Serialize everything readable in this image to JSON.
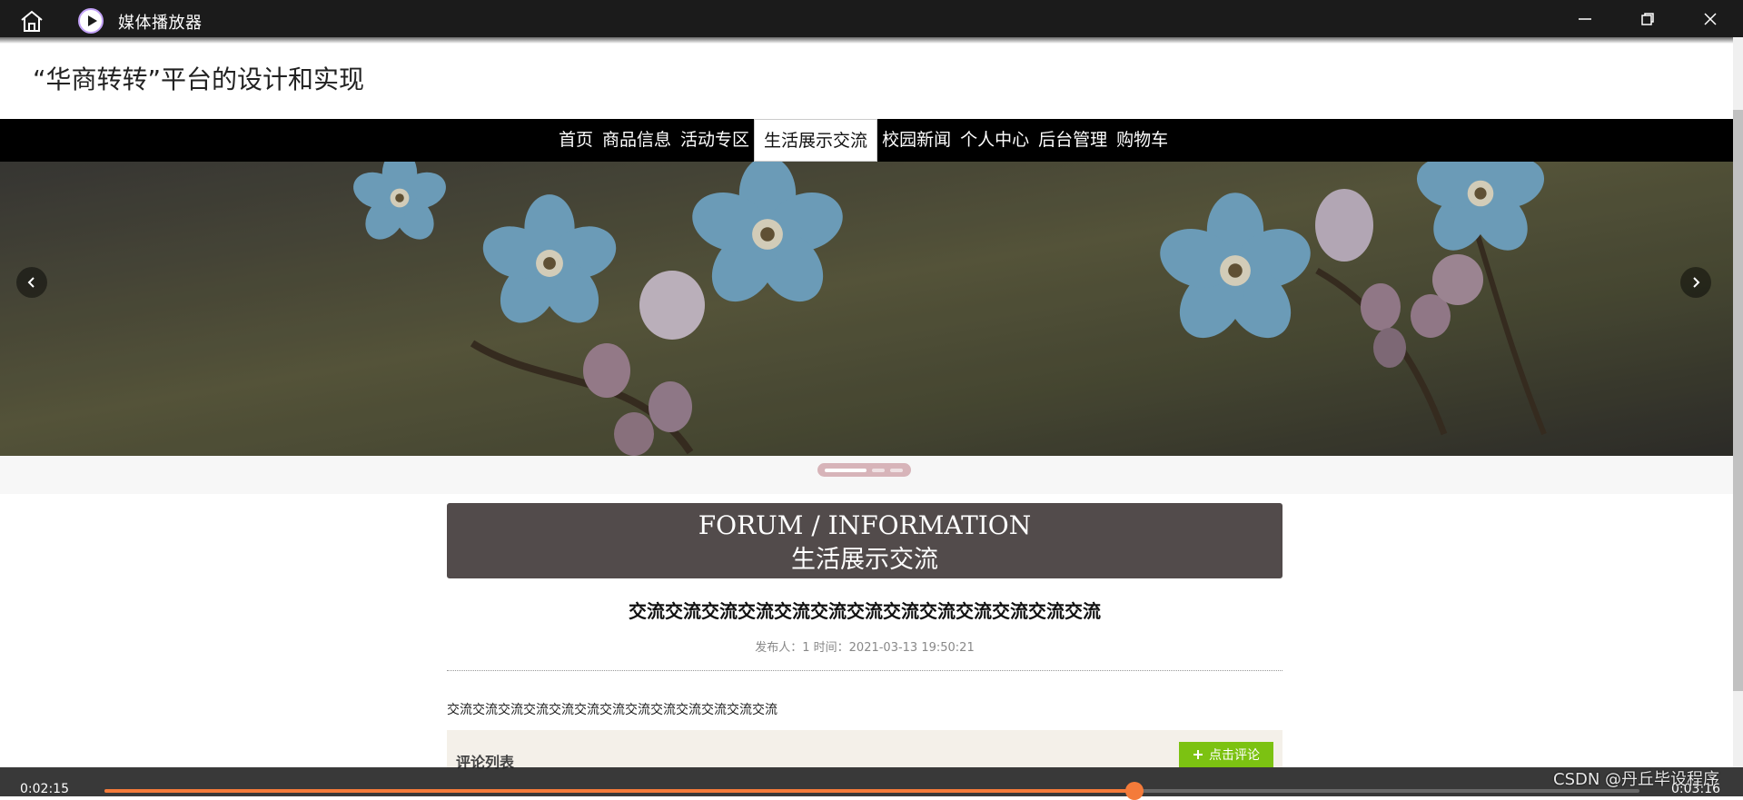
{
  "window": {
    "title": "媒体播放器",
    "icons": [
      "home-icon",
      "media-player-icon",
      "minimize-icon",
      "maximize-icon",
      "close-icon"
    ]
  },
  "site": {
    "title": "“华商转转”平台的设计和实现"
  },
  "nav": {
    "items": [
      "首页",
      "商品信息",
      "活动专区",
      "生活展示交流",
      "校园新闻",
      "个人中心",
      "后台管理",
      "购物车"
    ],
    "active_index": 3
  },
  "forum": {
    "heading_en": "FORUM / INFORMATION",
    "heading_cn": "生活展示交流"
  },
  "post": {
    "title": "交流交流交流交流交流交流交流交流交流交流交流交流交流",
    "meta": "发布人：1 时间：2021-03-13 19:50:21",
    "body": "交流交流交流交流交流交流交流交流交流交流交流交流交流"
  },
  "comments": {
    "label": "评论列表",
    "add_button": "点击评论"
  },
  "player": {
    "current_time": "0:02:15",
    "total_time": "0:03:16",
    "progress": 0.671
  },
  "watermark": "CSDN @丹丘毕设程序",
  "colors": {
    "accent": "#f47b3a",
    "nav_bg": "#000000",
    "forum_head_bg": "#524b4b",
    "comment_button": "#7cc212"
  }
}
